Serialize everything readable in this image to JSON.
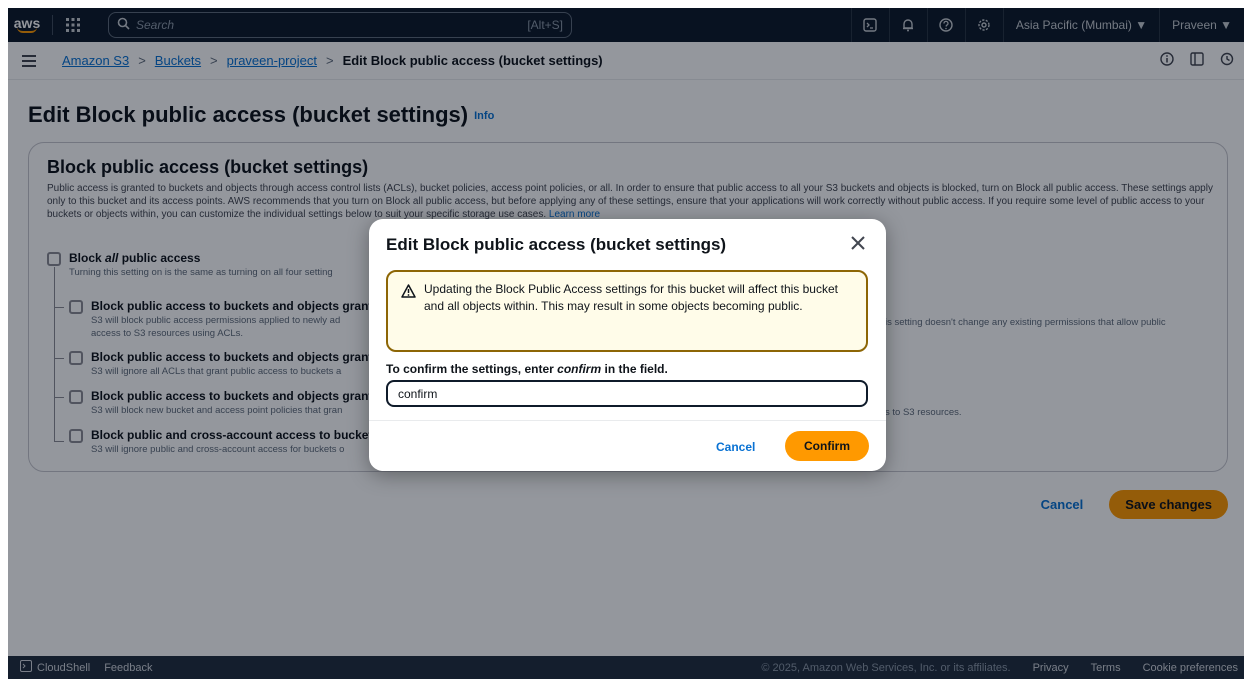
{
  "topnav": {
    "logo": "aws",
    "search_placeholder": "Search",
    "search_shortcut": "[Alt+S]",
    "region": "Asia Pacific (Mumbai) ▼",
    "user": "Praveen ▼",
    "icons": [
      "cloudshell-icon",
      "bell-icon",
      "help-icon",
      "settings-icon"
    ]
  },
  "breadcrumb": {
    "items": [
      "Amazon S3",
      "Buckets",
      "praveen-project"
    ],
    "current": "Edit Block public access (bucket settings)",
    "separator": ">"
  },
  "page": {
    "title": "Edit Block public access (bucket settings)",
    "info": "Info"
  },
  "panel": {
    "heading": "Block public access (bucket settings)",
    "description": "Public access is granted to buckets and objects through access control lists (ACLs), bucket policies, access point policies, or all. In order to ensure that public access to all your S3 buckets and objects is blocked, turn on Block all public access. These settings apply only to this bucket and its access points. AWS recommends that you turn on Block all public access, but before applying any of these settings, ensure that your applications will work correctly without public access. If you require some level of public access to your buckets or objects within, you can customize the individual settings below to suit your specific storage use cases.",
    "learn_more": "Learn more",
    "block_all_pre": "Block ",
    "block_all_em": "all",
    "block_all_post": " public access",
    "block_all_desc": "Turning this setting on is the same as turning on all four setting",
    "options": [
      {
        "title": "Block public access to buckets and objects granted",
        "desc": "S3 will block public access permissions applied to newly ad",
        "desc2": "access to S3 resources using ACLs.",
        "right": "is setting doesn't change any existing permissions that allow public"
      },
      {
        "title": "Block public access to buckets and objects granted",
        "desc": "S3 will ignore all ACLs that grant public access to buckets a",
        "right": ""
      },
      {
        "title": "Block public access to buckets and objects granted",
        "desc": "S3 will block new bucket and access point policies that gran",
        "right": "s to S3 resources."
      },
      {
        "title": "Block public and cross-account access to buckets a",
        "desc": "S3 will ignore public and cross-account access for buckets o",
        "right": ""
      }
    ],
    "cancel": "Cancel",
    "save": "Save changes"
  },
  "modal": {
    "title": "Edit Block public access (bucket settings)",
    "warning": "Updating the Block Public Access settings for this bucket will affect this bucket and all objects within. This may result in some objects becoming public.",
    "label_pre": "To confirm the settings, enter ",
    "label_em": "confirm",
    "label_post": " in the field.",
    "input_value": "confirm",
    "cancel": "Cancel",
    "confirm": "Confirm"
  },
  "footer": {
    "cloudshell": "CloudShell",
    "feedback": "Feedback",
    "copyright": "© 2025, Amazon Web Services, Inc. or its affiliates.",
    "privacy": "Privacy",
    "terms": "Terms",
    "cookies": "Cookie preferences"
  },
  "colors": {
    "nav": "#0f1b2a",
    "link": "#0972d3",
    "primary": "#ff9900",
    "warning_border": "#8d6605",
    "warning_bg": "#fffce9"
  }
}
